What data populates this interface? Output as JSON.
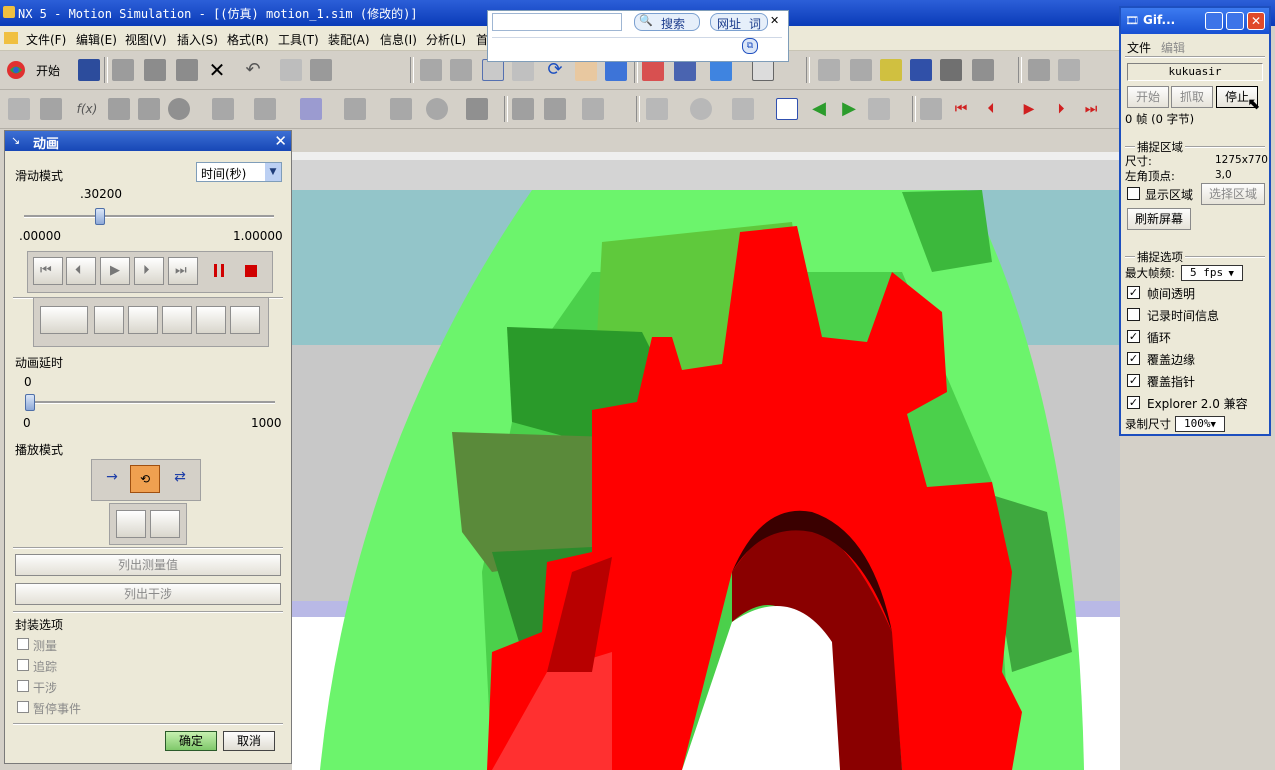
{
  "window": {
    "title": "NX 5 - Motion Simulation - [(仿真) motion_1.sim (修改的)]"
  },
  "menubar": {
    "items": [
      "文件(F)",
      "编辑(E)",
      "视图(V)",
      "插入(S)",
      "格式(R)",
      "工具(T)",
      "装配(A)",
      "信息(I)",
      "分析(L)",
      "首"
    ]
  },
  "toolbar": {
    "start_label": "开始"
  },
  "search_popup": {
    "search_label": "搜索",
    "address_label": "网址",
    "word_label": "词"
  },
  "animation_dialog": {
    "title": "动画",
    "slide_mode_label": "滑动模式",
    "slide_mode_value": "时间(秒)",
    "time_value": ".30200",
    "time_progress": 0.302,
    "time_min": ".00000",
    "time_max": "1.00000",
    "delay_label": "动画延时",
    "delay_value": "0",
    "delay_min": "0",
    "delay_max": "1000",
    "play_mode_label": "播放模式",
    "list_measure_label": "列出测量值",
    "list_interference_label": "列出干涉",
    "envelope_label": "封装选项",
    "envelope_options": [
      "测量",
      "追踪",
      "干涉",
      "暂停事件"
    ],
    "ok_label": "确定",
    "cancel_label": "取消"
  },
  "gif_recorder": {
    "title": "Gif...",
    "menu": [
      "文件",
      "编辑"
    ],
    "name": "kukuasir",
    "start_label": "开始",
    "capture_label": "抓取",
    "stop_label": "停止",
    "frame_info": "0 帧 (0 字节)",
    "capture_area_title": "捕捉区域",
    "size_label": "尺寸:",
    "size_value": "1275x770",
    "topleft_label": "左角顶点:",
    "topleft_value": "3,0",
    "show_area_label": "显示区域",
    "select_area_label": "选择区域",
    "refresh_label": "刷新屏幕",
    "capture_options_title": "捕捉选项",
    "max_fps_label": "最大帧频:",
    "max_fps_value": "5 fps",
    "options": [
      {
        "label": "帧间透明",
        "checked": true
      },
      {
        "label": "记录时间信息",
        "checked": false
      },
      {
        "label": "循环",
        "checked": true
      },
      {
        "label": "覆盖边缘",
        "checked": true
      },
      {
        "label": "覆盖指针",
        "checked": true
      },
      {
        "label": "Explorer 2.0 兼容",
        "checked": true
      }
    ],
    "record_size_label": "录制尺寸",
    "record_size_value": "100%"
  },
  "colors": {
    "gear_red": "#ff0000",
    "gear_green": "#66ff66",
    "title_blue": "#1747b6"
  }
}
